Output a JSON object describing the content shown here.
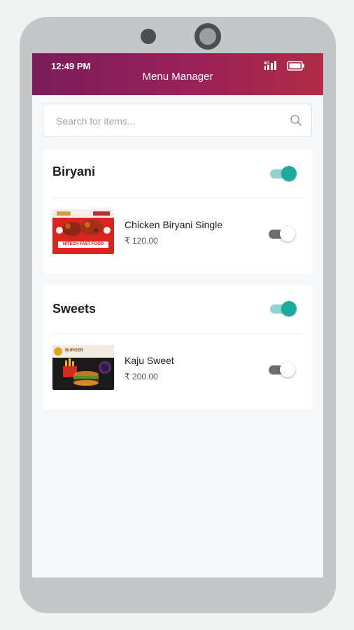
{
  "status_bar": {
    "time": "12:49 PM",
    "signal_icon": "signal-4g-icon",
    "battery_icon": "battery-icon"
  },
  "appbar": {
    "title": "Menu Manager",
    "gradient_colors": [
      "#7a1d5a",
      "#b02b46"
    ]
  },
  "search": {
    "placeholder": "Search for items...",
    "value": "",
    "icon": "search-icon"
  },
  "categories": [
    {
      "name": "Biryani",
      "enabled": true,
      "items": [
        {
          "name": "Chicken Biryani Single",
          "price": "₹ 120.00",
          "available": false,
          "image_banner": "HITECH FAST FOOD"
        }
      ]
    },
    {
      "name": "Sweets",
      "enabled": true,
      "items": [
        {
          "name": "Kaju Sweet",
          "price": "₹ 200.00",
          "available": false,
          "image_banner": "BURGER"
        }
      ]
    }
  ],
  "colors": {
    "accent_teal": "#1fa89d",
    "toggle_off": "#6e6f71"
  }
}
